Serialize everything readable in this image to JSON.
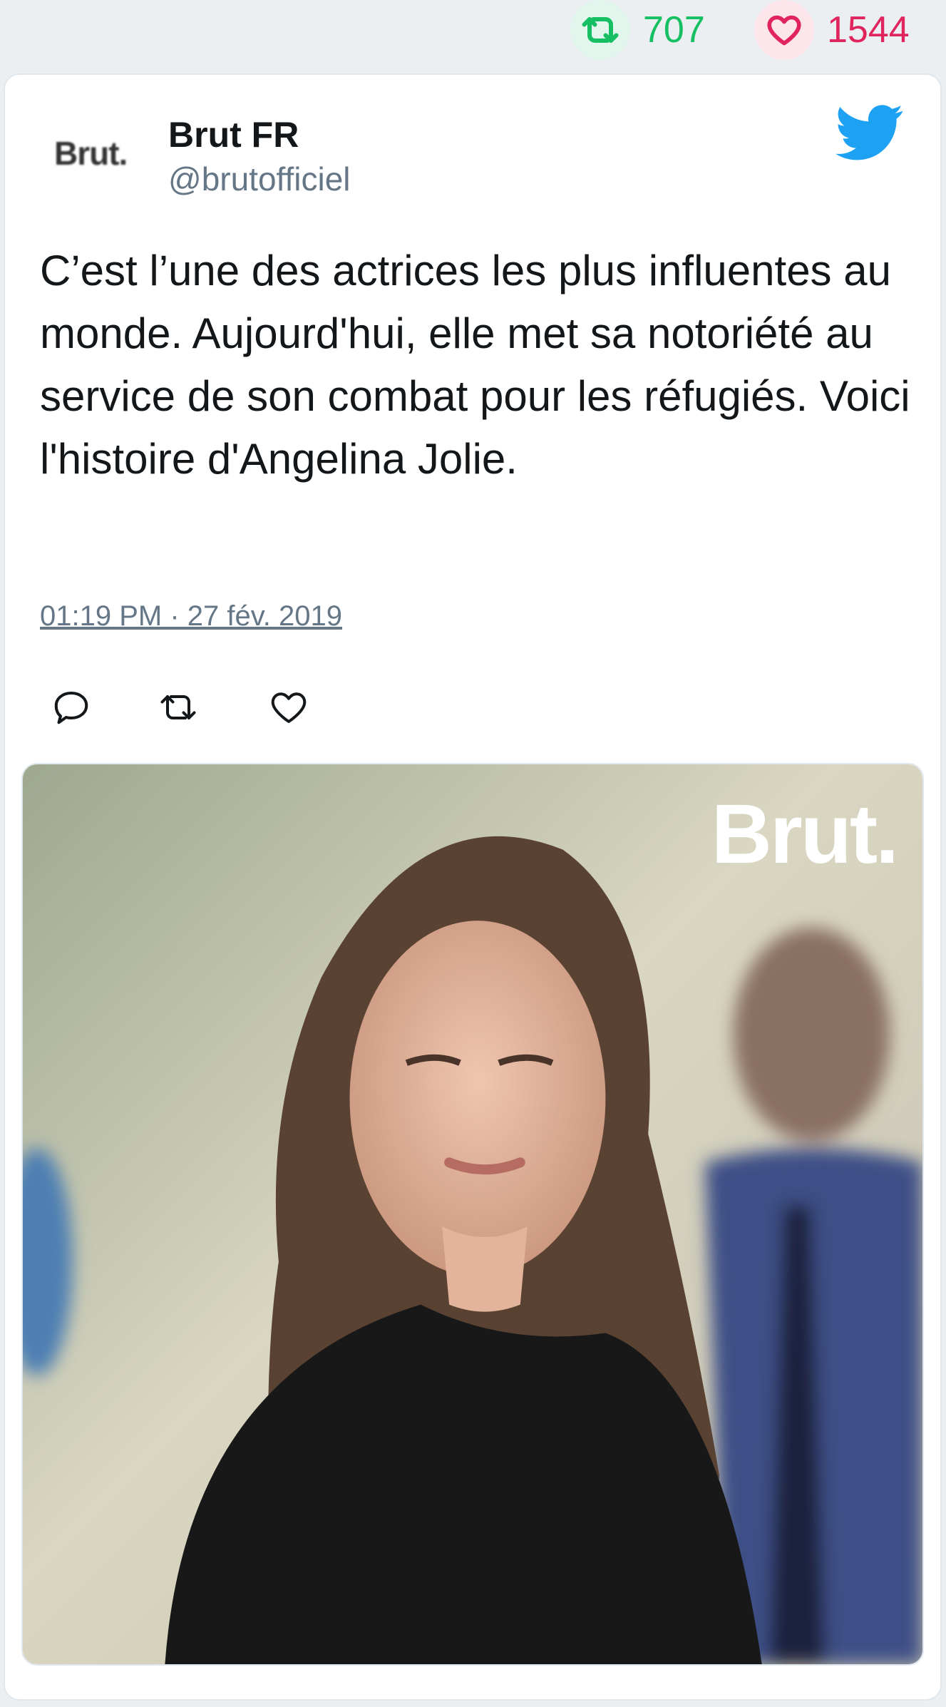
{
  "stats": {
    "retweet_icon": "retweet-icon",
    "retweet_count": "707",
    "like_icon": "heart-icon",
    "like_count": "1544",
    "retweet_color": "#17bf63",
    "like_color": "#e0245e"
  },
  "tweet": {
    "avatar_text": "Brut.",
    "display_name": "Brut FR",
    "handle": "@brutofficiel",
    "text": "C’est l’une des actrices les plus influentes au monde. Aujourd'hui, elle met sa notoriété au service de son combat pour les réfugiés. Voici l'histoire d'Angelina Jolie.",
    "timestamp": "01:19 PM · 27 fév. 2019",
    "brand_icon": "twitter-bird-icon",
    "actions": [
      "reply-icon",
      "retweet-icon",
      "heart-icon"
    ],
    "accent_color": "#1da1f2"
  },
  "media": {
    "watermark": "Brut."
  }
}
